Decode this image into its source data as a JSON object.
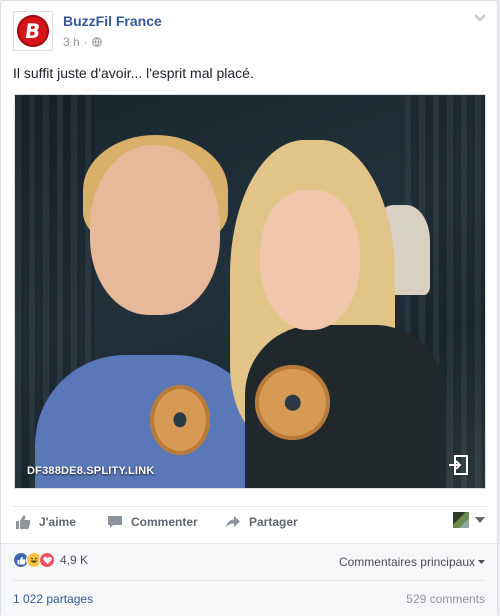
{
  "post": {
    "page_name": "BuzzFil France",
    "avatar_letter": "B",
    "time": "3 h",
    "separator": "·",
    "text": "Il suffit juste d'avoir... l'esprit mal placé.",
    "image": {
      "watermark": "DF388DE8.SPLITY.LINK"
    }
  },
  "actions": {
    "like_label": "J'aime",
    "comment_label": "Commenter",
    "share_label": "Partager"
  },
  "summary": {
    "reaction_count": "4,9 K",
    "top_comments_label": "Commentaires principaux",
    "shares_label": "1 022 partages",
    "comments_label": "529 comments"
  },
  "icons": {
    "privacy": "globe-icon",
    "menu": "chevron-down-icon",
    "like": "thumbs-up-icon",
    "comment": "speech-bubble-icon",
    "share": "share-arrow-icon",
    "open_media": "open-external-icon"
  },
  "colors": {
    "link_blue": "#365899",
    "brand_red": "#d7141a",
    "like_blue": "#4267b2",
    "love_red": "#f25268",
    "haha_yellow": "#f7c542"
  }
}
